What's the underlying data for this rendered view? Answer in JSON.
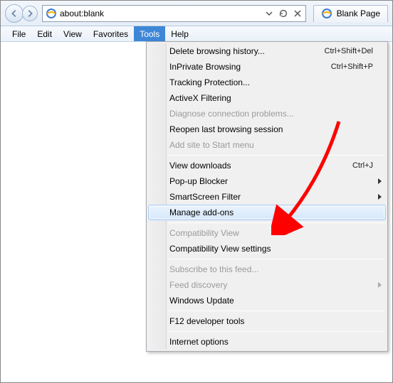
{
  "address": {
    "url": "about:blank"
  },
  "tab": {
    "title": "Blank Page"
  },
  "menubar": {
    "items": [
      {
        "label": "File"
      },
      {
        "label": "Edit"
      },
      {
        "label": "View"
      },
      {
        "label": "Favorites"
      },
      {
        "label": "Tools"
      },
      {
        "label": "Help"
      }
    ],
    "open_index": 4
  },
  "dropdown": {
    "groups": [
      [
        {
          "label": "Delete browsing history...",
          "shortcut": "Ctrl+Shift+Del"
        },
        {
          "label": "InPrivate Browsing",
          "shortcut": "Ctrl+Shift+P"
        },
        {
          "label": "Tracking Protection..."
        },
        {
          "label": "ActiveX Filtering"
        },
        {
          "label": "Diagnose connection problems...",
          "disabled": true
        },
        {
          "label": "Reopen last browsing session"
        },
        {
          "label": "Add site to Start menu",
          "disabled": true
        }
      ],
      [
        {
          "label": "View downloads",
          "shortcut": "Ctrl+J"
        },
        {
          "label": "Pop-up Blocker",
          "submenu": true
        },
        {
          "label": "SmartScreen Filter",
          "submenu": true
        },
        {
          "label": "Manage add-ons",
          "highlight": true
        }
      ],
      [
        {
          "label": "Compatibility View",
          "disabled": true
        },
        {
          "label": "Compatibility View settings"
        }
      ],
      [
        {
          "label": "Subscribe to this feed...",
          "disabled": true
        },
        {
          "label": "Feed discovery",
          "disabled": true,
          "submenu": true
        },
        {
          "label": "Windows Update"
        }
      ],
      [
        {
          "label": "F12 developer tools"
        }
      ],
      [
        {
          "label": "Internet options"
        }
      ]
    ]
  },
  "annotation": {
    "color": "#ff0000"
  }
}
